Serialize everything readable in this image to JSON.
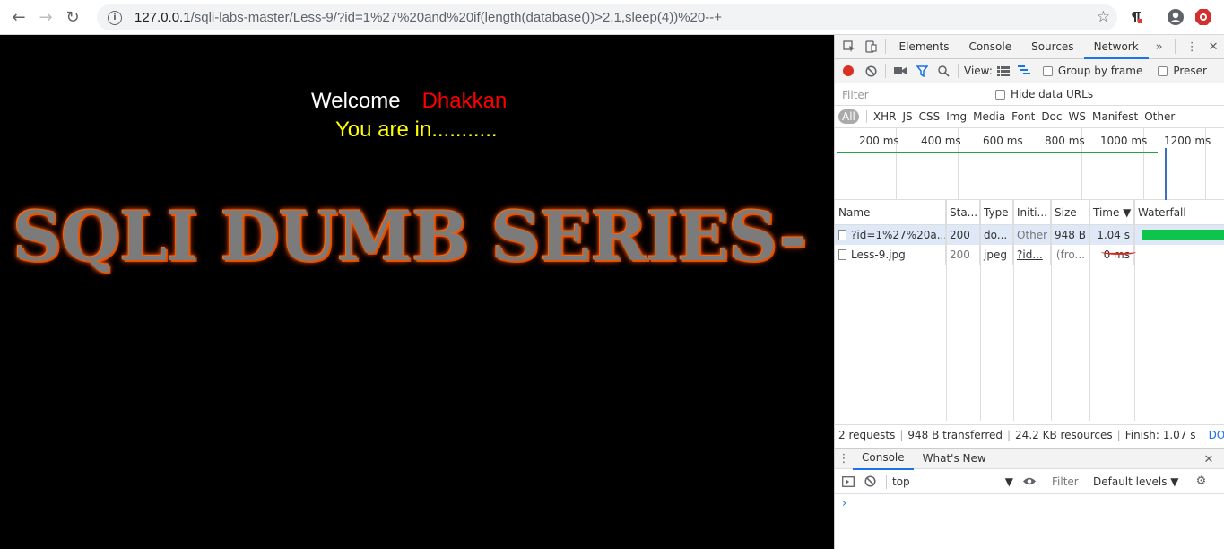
{
  "browser": {
    "url_host": "127.0.0.1",
    "url_path": "/sqli-labs-master/Less-9/?id=1%27%20and%20if(length(database())>2,1,sleep(4))%20--+"
  },
  "page": {
    "welcome_label": "Welcome",
    "welcome_name": "Dhakkan",
    "status_message": "You are in...........",
    "banner_text": "SQLI DUMB SERIES-",
    "colors": {
      "background": "#000000",
      "welcome": "#ffffff",
      "name": "#ff0000",
      "message": "#ffff00",
      "banner_glow": "#ff6a00"
    }
  },
  "devtools": {
    "tabs": [
      "Elements",
      "Console",
      "Sources",
      "Network"
    ],
    "active_tab": "Network",
    "toolbar": {
      "view_label": "View:",
      "group_by_frame": "Group by frame",
      "preserve_log": "Preser"
    },
    "filter_placeholder": "Filter",
    "hide_data_urls": "Hide data URLs",
    "type_filters": [
      "All",
      "XHR",
      "JS",
      "CSS",
      "Img",
      "Media",
      "Font",
      "Doc",
      "WS",
      "Manifest",
      "Other"
    ],
    "timeline_labels": [
      "200 ms",
      "400 ms",
      "600 ms",
      "800 ms",
      "1000 ms",
      "1200 ms"
    ],
    "columns": [
      "Name",
      "Sta...",
      "Type",
      "Initi...",
      "Size",
      "Time ▼",
      "Waterfall"
    ],
    "rows": [
      {
        "name": "?id=1%27%20a...",
        "status": "200",
        "type": "do...",
        "initiator": "Other",
        "size": "948 B",
        "time": "1.04 s"
      },
      {
        "name": "Less-9.jpg",
        "status": "200",
        "type": "jpeg",
        "initiator": "?id...",
        "size": "(fro...",
        "time": "0 ms"
      }
    ],
    "summary": {
      "requests": "2 requests",
      "transferred": "948 B transferred",
      "resources": "24.2 KB resources",
      "finish": "Finish: 1.07 s",
      "domcontent": "DOMCont..."
    },
    "drawer": {
      "tabs": [
        "Console",
        "What's New"
      ],
      "context": "top",
      "filter_placeholder": "Filter",
      "levels": "Default levels ▼",
      "prompt": "›"
    }
  }
}
